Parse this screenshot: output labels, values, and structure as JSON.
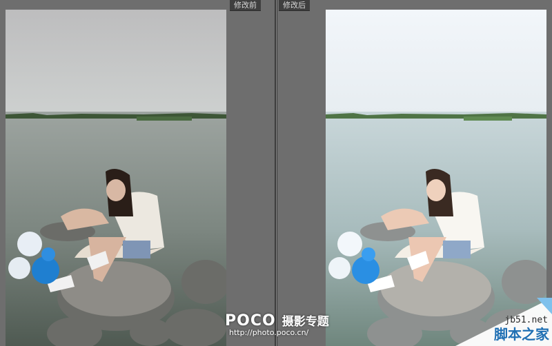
{
  "panels": {
    "before_label": "修改前",
    "after_label": "修改后"
  },
  "watermark": {
    "brand": "POCO",
    "topic": "摄影专题",
    "url": "http://photo.poco.cn/"
  },
  "corner_badge": {
    "site": "jb51.net",
    "name": "脚本之家"
  },
  "colors": {
    "background": "#6e6e6e",
    "divider": "#3a3a3a",
    "label_bg": "#3f3f3f",
    "balloon_blue": "#1f7fd0",
    "balloon_white": "#e8eef5"
  }
}
